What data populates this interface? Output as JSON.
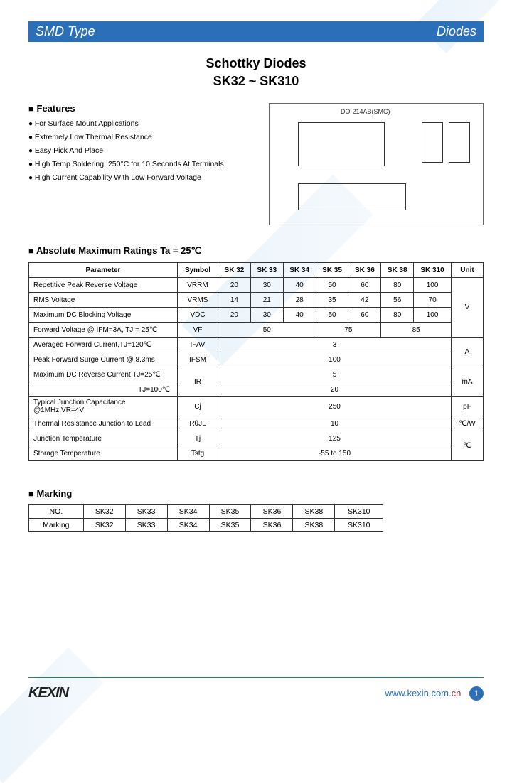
{
  "header": {
    "left": "SMD Type",
    "right": "Diodes"
  },
  "title": {
    "line1": "Schottky Diodes",
    "line2": "SK32 ~ SK310"
  },
  "features": {
    "heading": "Features",
    "items": [
      "For Surface Mount Applications",
      "Extremely Low Thermal Resistance",
      "Easy Pick And Place",
      "High Temp Soldering: 250°C for 10 Seconds At Terminals",
      "High Current Capability With Low Forward Voltage"
    ]
  },
  "package_label": "DO-214AB(SMC)",
  "abs_max": {
    "heading": "Absolute Maximum Ratings Ta = 25℃",
    "columns": [
      "Parameter",
      "Symbol",
      "SK 32",
      "SK 33",
      "SK 34",
      "SK 35",
      "SK 36",
      "SK 38",
      "SK 310",
      "Unit"
    ],
    "rows": [
      {
        "param": "Repetitive Peak Reverse Voltage",
        "symbol": "VRRM",
        "v": [
          "20",
          "30",
          "40",
          "50",
          "60",
          "80",
          "100"
        ],
        "unit": "V",
        "unit_rowspan": 3
      },
      {
        "param": "RMS Voltage",
        "symbol": "VRMS",
        "v": [
          "14",
          "21",
          "28",
          "35",
          "42",
          "56",
          "70"
        ]
      },
      {
        "param": "Maximum DC Blocking Voltage",
        "symbol": "VDC",
        "v": [
          "20",
          "30",
          "40",
          "50",
          "60",
          "80",
          "100"
        ]
      },
      {
        "param": "Forward Voltage @ IFM=3A, TJ = 25℃",
        "symbol": "VF",
        "merged": [
          {
            "span": 3,
            "val": "50"
          },
          {
            "span": 2,
            "val": "75"
          },
          {
            "span": 2,
            "val": "85"
          }
        ],
        "unit": ""
      },
      {
        "param": "Averaged Forward Current,TJ=120℃",
        "symbol": "IFAV",
        "merged": [
          {
            "span": 7,
            "val": "3"
          }
        ],
        "unit": "A",
        "unit_rowspan": 2
      },
      {
        "param": "Peak Forward Surge Current @ 8.3ms",
        "symbol": "IFSM",
        "merged": [
          {
            "span": 7,
            "val": "100"
          }
        ]
      },
      {
        "param": "Maximum DC Reverse Current   TJ=25℃",
        "param2": "TJ=100℃",
        "symbol": "IR",
        "symbol_rowspan": 2,
        "merged": [
          {
            "span": 7,
            "val": "5"
          }
        ],
        "unit": "mA",
        "unit_rowspan": 2
      },
      {
        "merged": [
          {
            "span": 7,
            "val": "20"
          }
        ]
      },
      {
        "param": "Typical Junction Capacitance @1MHz,VR=4V",
        "symbol": "Cj",
        "merged": [
          {
            "span": 7,
            "val": "250"
          }
        ],
        "unit": "pF"
      },
      {
        "param": "Thermal Resistance Junction to Lead",
        "symbol": "RθJL",
        "merged": [
          {
            "span": 7,
            "val": "10"
          }
        ],
        "unit": "℃/W"
      },
      {
        "param": "Junction Temperature",
        "symbol": "Tj",
        "merged": [
          {
            "span": 7,
            "val": "125"
          }
        ],
        "unit": "℃",
        "unit_rowspan": 2
      },
      {
        "param": "Storage Temperature",
        "symbol": "Tstg",
        "merged": [
          {
            "span": 7,
            "val": "-55 to 150"
          }
        ]
      }
    ]
  },
  "marking": {
    "heading": "Marking",
    "header_row": [
      "NO.",
      "SK32",
      "SK33",
      "SK34",
      "SK35",
      "SK36",
      "SK38",
      "SK310"
    ],
    "data_row": [
      "Marking",
      "SK32",
      "SK33",
      "SK34",
      "SK35",
      "SK36",
      "SK38",
      "SK310"
    ]
  },
  "footer": {
    "logo": "KEXIN",
    "url_prefix": "www.",
    "url_mid": "kexin",
    "url_suffix": ".com.",
    "url_cn": "cn",
    "page": "1"
  }
}
